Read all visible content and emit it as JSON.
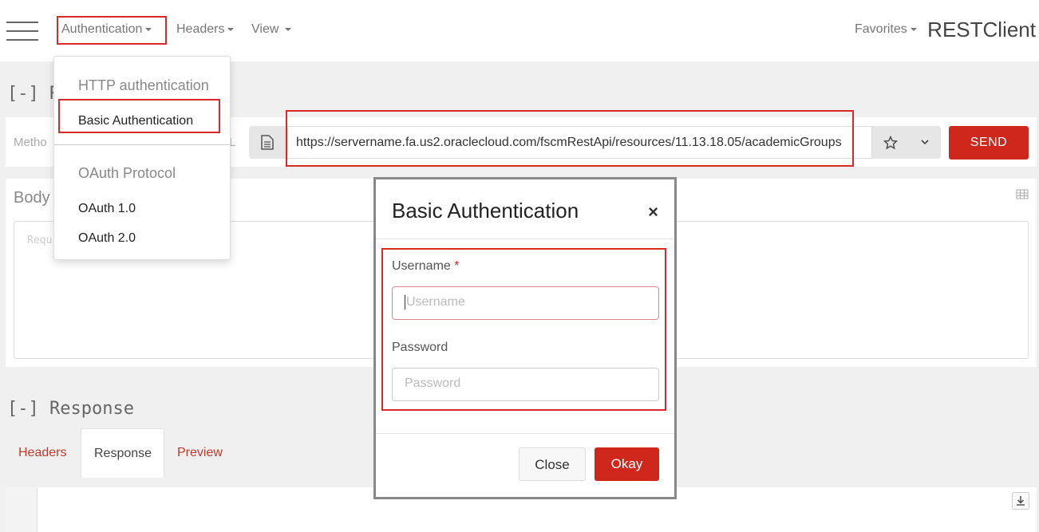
{
  "navbar": {
    "menus": [
      {
        "label": "Authentication"
      },
      {
        "label": "Headers"
      },
      {
        "label": "View"
      }
    ],
    "favorites": "Favorites",
    "brand": "RESTClient"
  },
  "request": {
    "section_title": "[-] R",
    "method_label": "Metho",
    "url_label_tail": "L",
    "url": "https://servername.fa.us2.oraclecloud.com/fscmRestApi/resources/11.13.18.05/academicGroups",
    "send_label": "SEND",
    "body_label": "Body",
    "body_placeholder": "Requ"
  },
  "response": {
    "section_title": "[-] Response",
    "tabs": [
      {
        "label": "Headers"
      },
      {
        "label": "Response"
      },
      {
        "label": "Preview"
      }
    ]
  },
  "auth_dropdown": {
    "http_header": "HTTP authentication",
    "basic": "Basic Authentication",
    "oauth_header": "OAuth Protocol",
    "oauth1": "OAuth 1.0",
    "oauth2": "OAuth 2.0"
  },
  "modal": {
    "title": "Basic Authentication",
    "close_symbol": "×",
    "username_label": "Username",
    "required_mark": "*",
    "username_placeholder": "Username",
    "password_label": "Password",
    "password_placeholder": "Password",
    "close_button": "Close",
    "okay_button": "Okay"
  },
  "colors": {
    "accent": "#d0271d",
    "highlight_box": "#d92a2a"
  }
}
